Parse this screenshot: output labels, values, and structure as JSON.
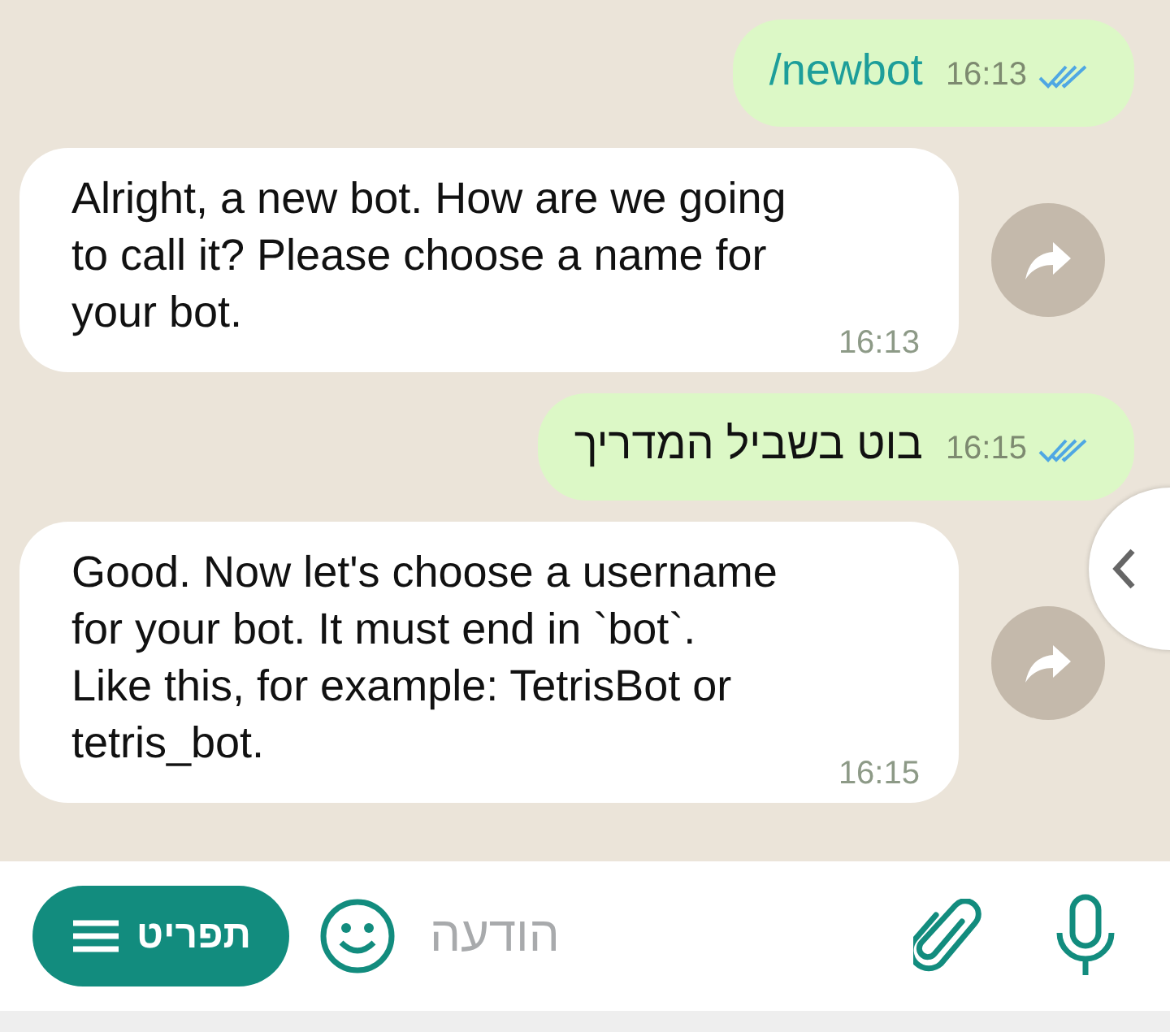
{
  "messages": [
    {
      "kind": "outgoing",
      "text": "/newbot",
      "is_command": true,
      "time": "16:13",
      "read": true
    },
    {
      "kind": "incoming",
      "text": "Alright, a new bot. How are we going to call it? Please choose a name for your bot.",
      "is_command": false,
      "time": "16:13"
    },
    {
      "kind": "outgoing",
      "text": "בוט בשביל המדריך",
      "is_command": false,
      "time": "16:15",
      "read": true
    },
    {
      "kind": "incoming",
      "text": "Good. Now let's choose a username for your bot. It must end in `bot`. Like this, for example: TetrisBot or tetris_bot.",
      "is_command": false,
      "time": "16:15"
    }
  ],
  "composer": {
    "menu_button": "תפריט",
    "placeholder": "הודעה"
  }
}
